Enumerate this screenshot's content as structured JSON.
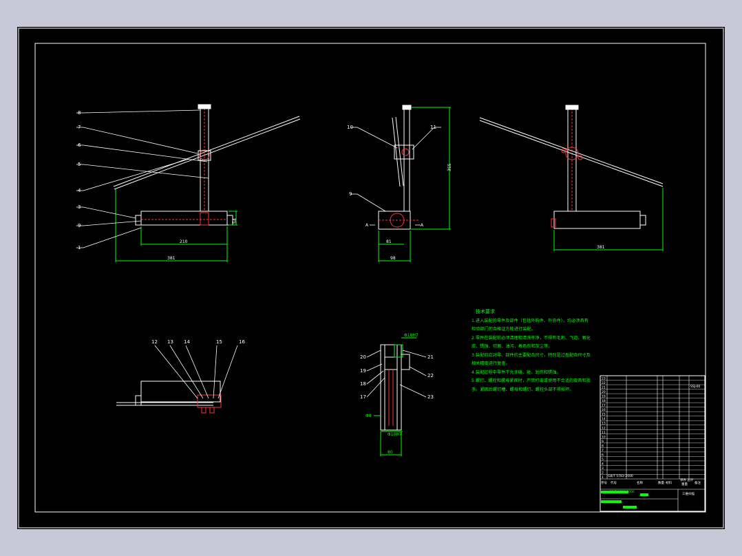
{
  "views": {
    "front": {
      "balloons": [
        "8",
        "7",
        "6",
        "5",
        "4",
        "3",
        "9",
        "1"
      ],
      "dims": {
        "base_width": "210",
        "overall_width": "381",
        "height": "54"
      }
    },
    "side": {
      "balloons": [
        "10",
        "11",
        "9"
      ],
      "dims": {
        "height": "355",
        "w1": "81",
        "w2": "98"
      },
      "markers": [
        "A",
        "A"
      ]
    },
    "rear": {
      "dims": {
        "overall_width": "381"
      }
    },
    "section": {
      "balloons": [
        "12",
        "13",
        "14",
        "15",
        "16"
      ]
    },
    "detail": {
      "balloons": [
        "20",
        "19",
        "18",
        "17",
        "21",
        "22",
        "23"
      ],
      "dims": {
        "top": "Φ18H7",
        "width": "80",
        "side": "Φ8",
        "bottom": "Φ10H7"
      }
    }
  },
  "notes": {
    "title": "技术要求",
    "lines": [
      "1.进入装配的零件及部件（包括外购件、外协件），均必须具有",
      "检验部门的合格证方能进行装配。",
      "2.零件在装配前必须清理和清洗干净，不得有毛刺、飞边、氧化",
      "皮、锈蚀、切屑、油污、着色剂和灰尘等。",
      "3.装配前应对零、部件的主要配合尺寸，特别是过盈配合尺寸及",
      "相关精度进行复查。",
      "4.装配过程中零件不允许磕、碰、划伤和锈蚀。",
      "5.螺钉、螺栓和螺母紧固时，严禁打击或使用不合适的旋具和扳",
      "手。紧固后螺钉槽、螺母和螺钉、螺栓头部不得损坏。"
    ]
  },
  "title_block": {
    "drawing_name": "三维扫描",
    "code": "SSJ-00",
    "col_headers": [
      "序号",
      "代号",
      "名称",
      "数量",
      "材料",
      "单件 总计",
      "重量",
      "备注"
    ],
    "rows": [
      "23",
      "22",
      "21",
      "20",
      "19",
      "18",
      "17",
      "16",
      "15",
      "14",
      "13",
      "12",
      "11",
      "10",
      "9",
      "8",
      "7",
      "6",
      "5",
      "4",
      "3",
      "2",
      "1"
    ],
    "special_cells": [
      "GB/T 5783-2000",
      "GB/T 5783-2000"
    ]
  }
}
